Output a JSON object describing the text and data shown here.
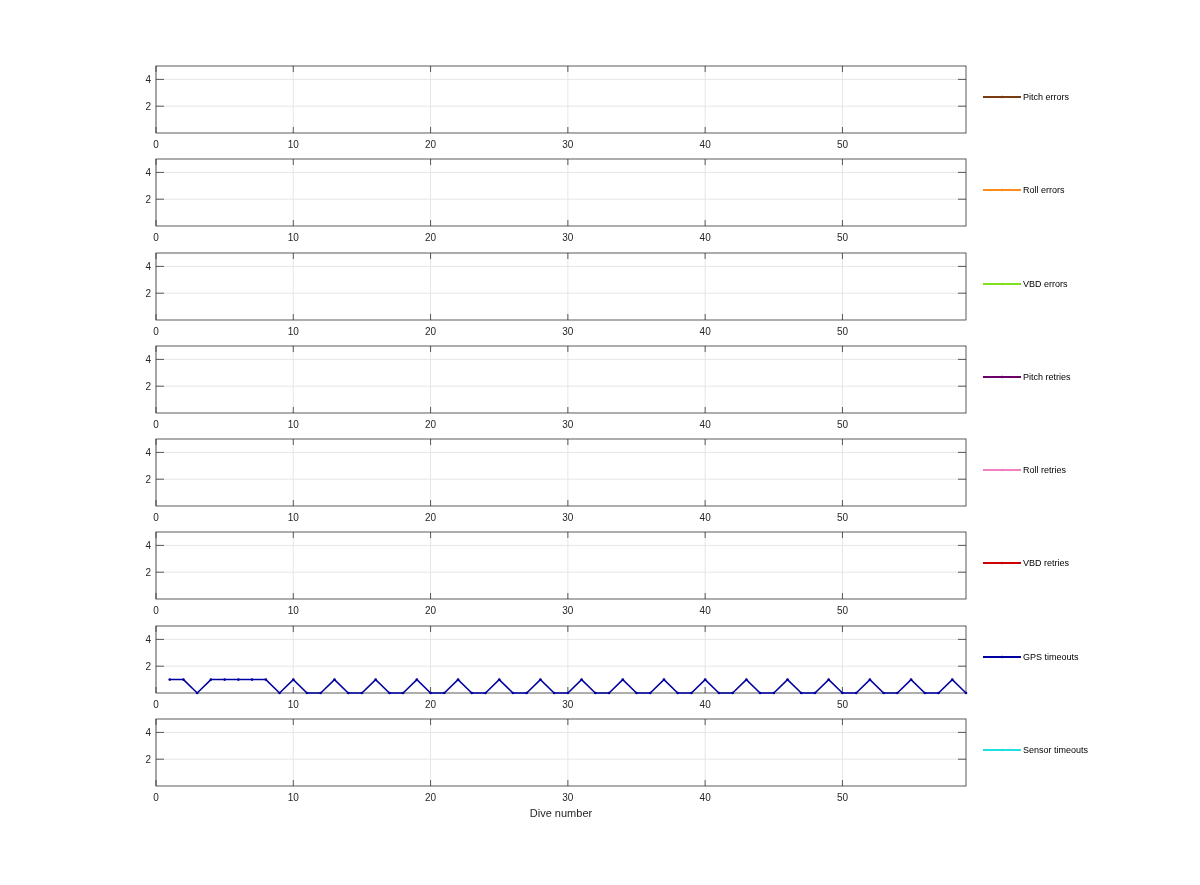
{
  "figure": {
    "subplots": [
      {
        "kind": "empty",
        "x_tick_labels": [
          "0",
          "10",
          "20",
          "30",
          "40",
          "50"
        ],
        "y_tick_labels": [
          "4",
          "2"
        ],
        "legend": {
          "label": "Pitch errors",
          "color": "#7a3b10"
        }
      },
      {
        "kind": "empty",
        "x_tick_labels": [
          "0",
          "10",
          "20",
          "30",
          "40",
          "50"
        ],
        "y_tick_labels": [
          "4",
          "2"
        ],
        "legend": {
          "label": "Roll errors",
          "color": "#ff8c1a"
        }
      },
      {
        "kind": "empty",
        "x_tick_labels": [
          "0",
          "10",
          "20",
          "30",
          "40",
          "50"
        ],
        "y_tick_labels": [
          "4",
          "2"
        ],
        "legend": {
          "label": "VBD errors",
          "color": "#80e020"
        }
      },
      {
        "kind": "empty",
        "x_tick_labels": [
          "0",
          "10",
          "20",
          "30",
          "40",
          "50"
        ],
        "y_tick_labels": [
          "4",
          "2"
        ],
        "legend": {
          "label": "Pitch retries",
          "color": "#6a006a"
        }
      },
      {
        "kind": "empty",
        "x_tick_labels": [
          "0",
          "10",
          "20",
          "30",
          "40",
          "50"
        ],
        "y_tick_labels": [
          "4",
          "2"
        ],
        "legend": {
          "label": "Roll retries",
          "color": "#f080c0"
        }
      },
      {
        "kind": "empty",
        "x_tick_labels": [
          "0",
          "10",
          "20",
          "30",
          "40",
          "50"
        ],
        "y_tick_labels": [
          "4",
          "2"
        ],
        "legend": {
          "label": "VBD retries",
          "color": "#cc0000"
        }
      },
      {
        "kind": "chart",
        "chart_data": {
          "type": "line",
          "grid": true,
          "xlim": [
            0,
            59
          ],
          "ylim": [
            0,
            5
          ],
          "xticks": [
            0,
            10,
            20,
            30,
            40,
            50
          ],
          "yticks": [
            2,
            4
          ],
          "x": [
            1,
            2,
            3,
            4,
            5,
            6,
            7,
            8,
            9,
            10,
            11,
            12,
            13,
            14,
            15,
            16,
            17,
            18,
            19,
            20,
            21,
            22,
            23,
            24,
            25,
            26,
            27,
            28,
            29,
            30,
            31,
            32,
            33,
            34,
            35,
            36,
            37,
            38,
            39,
            40,
            41,
            42,
            43,
            44,
            45,
            46,
            47,
            48,
            49,
            50,
            51,
            52,
            53,
            54,
            55,
            56,
            57,
            58,
            59
          ],
          "series": [
            {
              "name": "GPS timeouts",
              "color": "#0000a0",
              "values": [
                1,
                1,
                0,
                1,
                1,
                1,
                1,
                1,
                0,
                1,
                0,
                0,
                1,
                0,
                0,
                1,
                0,
                0,
                1,
                0,
                0,
                1,
                0,
                0,
                1,
                0,
                0,
                1,
                0,
                0,
                1,
                0,
                0,
                1,
                0,
                0,
                1,
                0,
                0,
                1,
                0,
                0,
                1,
                0,
                0,
                1,
                0,
                0,
                1,
                0,
                0,
                1,
                0,
                0,
                1,
                0,
                0,
                1,
                0
              ]
            }
          ]
        }
      },
      {
        "kind": "empty",
        "x_tick_labels": [
          "0",
          "10",
          "20",
          "30",
          "40",
          "50"
        ],
        "y_tick_labels": [
          "4",
          "2"
        ],
        "x_axis_title": "Dive number",
        "legend": {
          "label": "Sensor timeouts",
          "color": "#20e0e0"
        }
      }
    ]
  }
}
